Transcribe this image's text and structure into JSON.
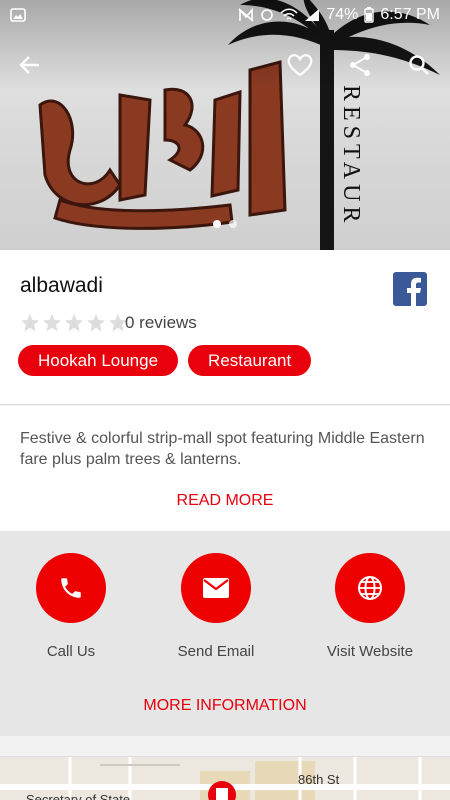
{
  "status_bar": {
    "battery": "74%",
    "time": "6:57 PM"
  },
  "toolbar": {
    "back_icon": "arrow-left-icon",
    "favorite_icon": "heart-icon",
    "share_icon": "share-icon",
    "search_icon": "search-icon"
  },
  "hero": {
    "logo_vertical_text": "RESTAUR",
    "logo_arabic_text": "البوادي",
    "slide_count": 2,
    "active_slide": 1
  },
  "business": {
    "name": "albawadi",
    "rating": 0,
    "reviews_label": "0 reviews",
    "tags": [
      "Hookah Lounge",
      "Restaurant"
    ],
    "facebook_icon": "facebook-icon"
  },
  "description": {
    "text": "Festive & colorful strip-mall spot featuring Middle Eastern fare plus palm trees & lanterns.",
    "read_more": "READ MORE"
  },
  "actions": {
    "call_label": "Call Us",
    "email_label": "Send Email",
    "website_label": "Visit Website",
    "more_info": "MORE INFORMATION"
  },
  "map": {
    "street_label": "86th St",
    "place_label": "Secretary of State"
  },
  "colors": {
    "accent": "#e8000d",
    "facebook": "#3b5998"
  }
}
